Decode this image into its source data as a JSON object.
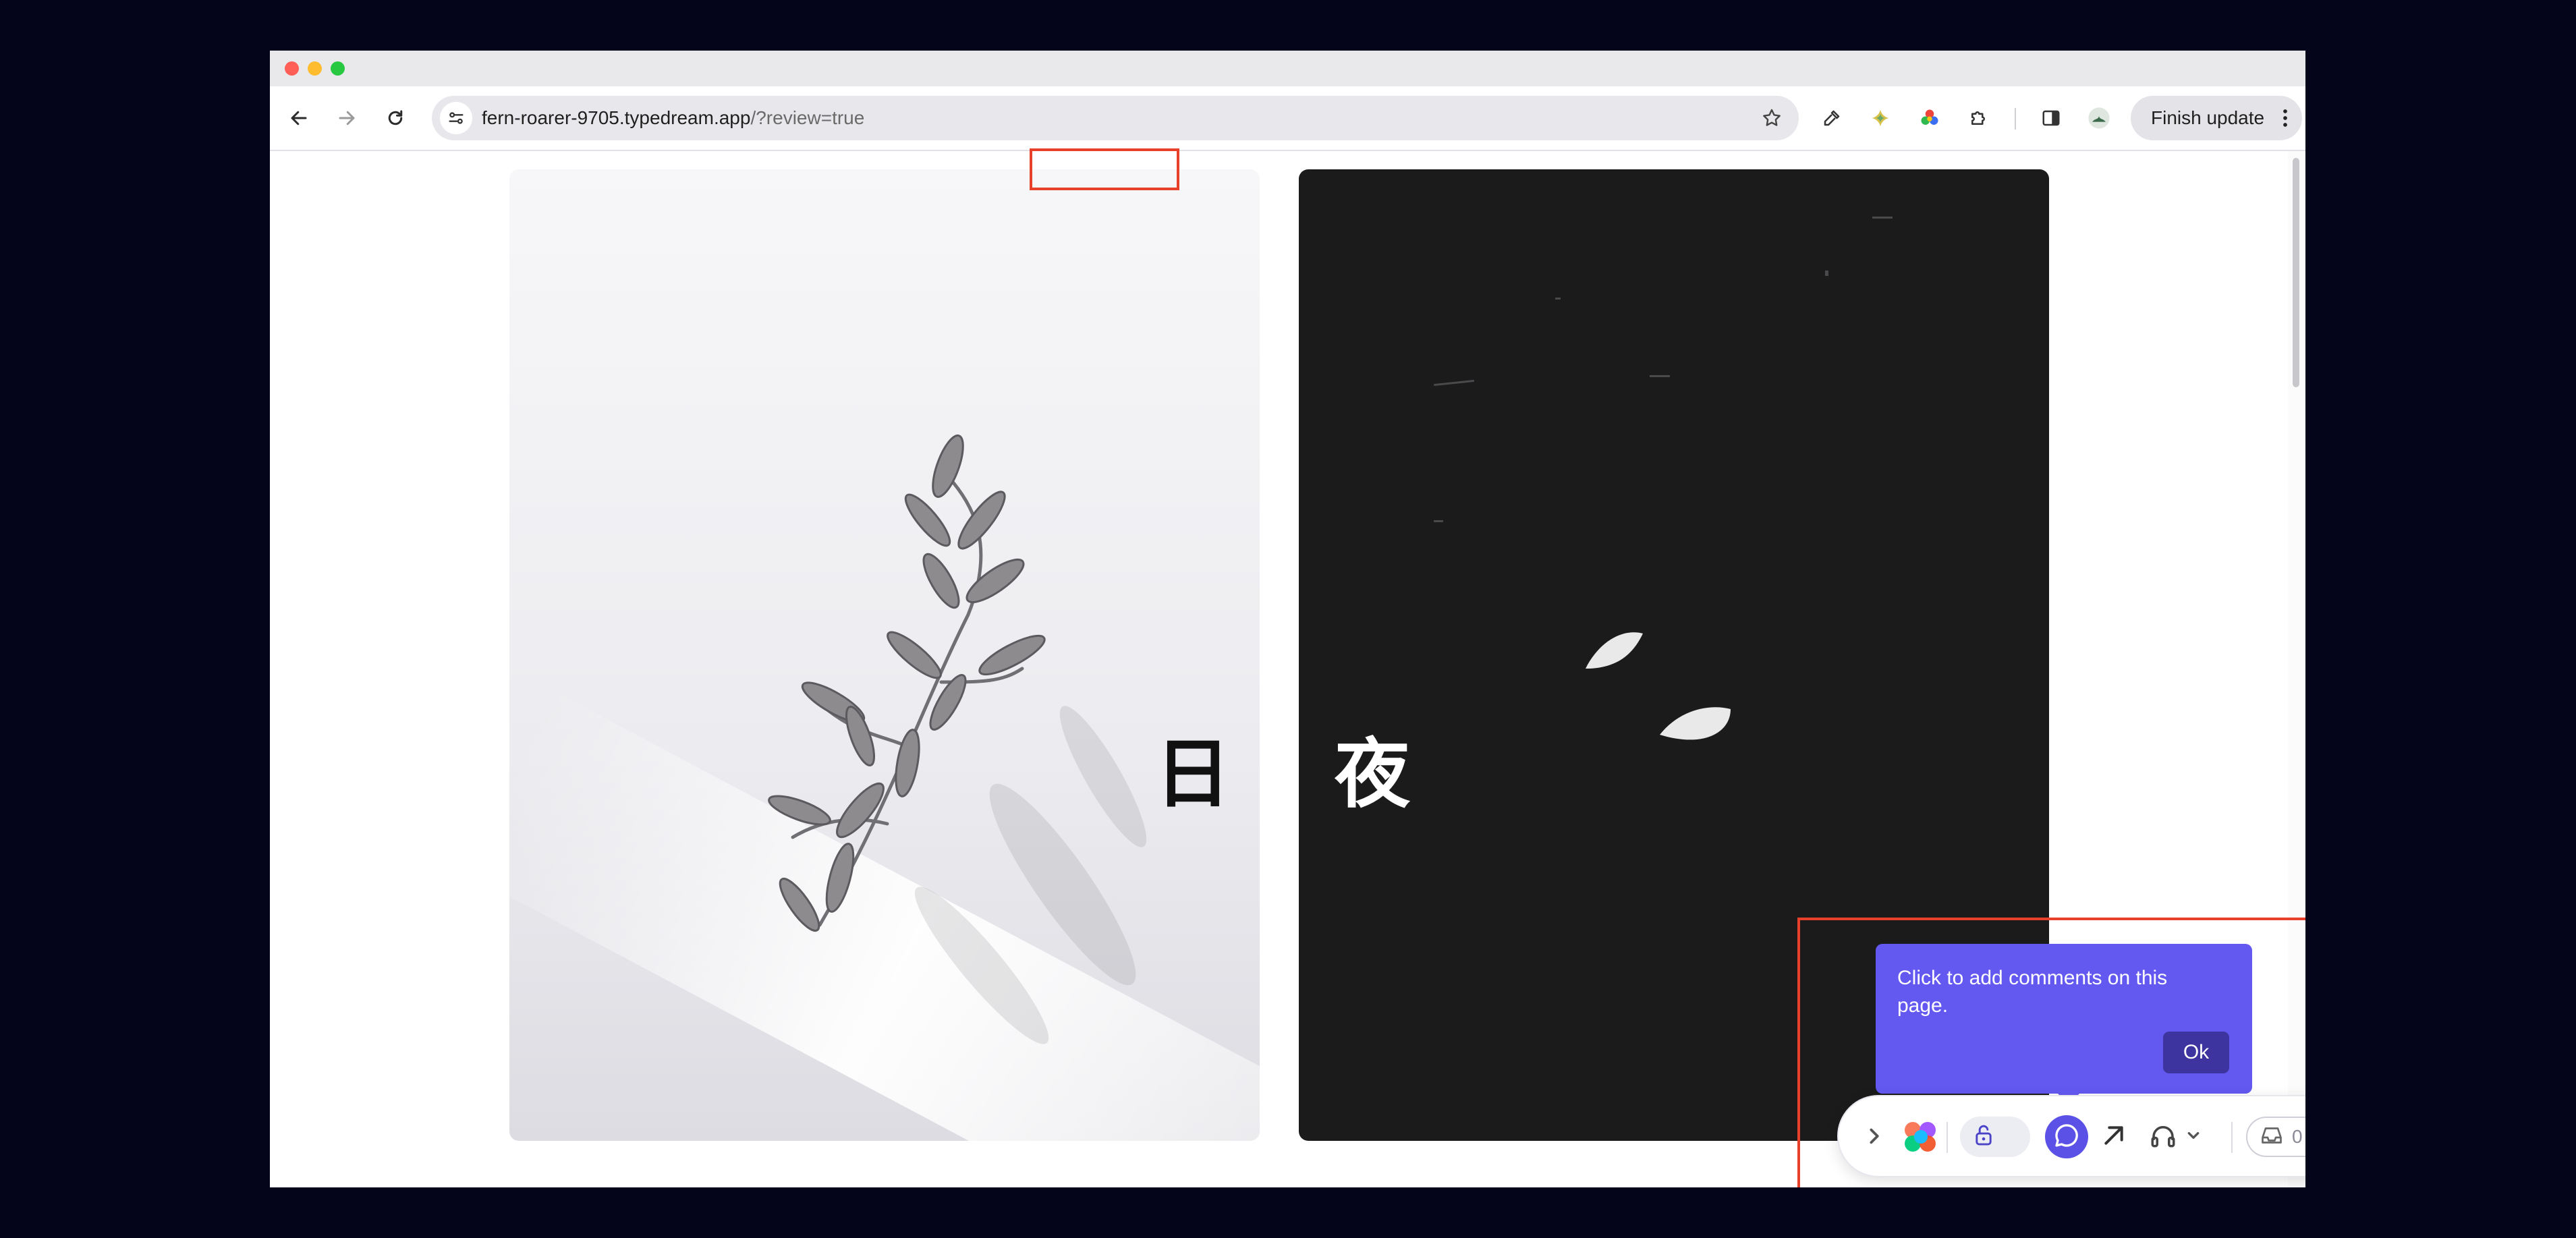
{
  "browser": {
    "url_host": "fern-roarer-9705.typedream.app",
    "url_query": "/?review=true",
    "finish_update_label": "Finish update",
    "icons": [
      "back-icon",
      "forward-icon",
      "reload-icon",
      "site-settings-icon",
      "bookmark-star-icon",
      "eyedropper-extension-icon",
      "gemini-extension-icon",
      "color-wheel-extension-icon",
      "extensions-puzzle-icon",
      "side-panel-icon",
      "profile-icon",
      "more-vert-icon"
    ]
  },
  "page": {
    "day_glyph": "日",
    "night_glyph": "夜"
  },
  "tooltip": {
    "text": "Click to add comments on this page.",
    "ok_label": "Ok"
  },
  "review_bar": {
    "inbox_count": "0",
    "icons": [
      "expand-chevron-icon",
      "figma-logo-icon",
      "unlock-icon",
      "comment-icon",
      "arrow-icon",
      "headphones-icon",
      "inbox-icon",
      "share-icon",
      "avatar",
      "more-vert-icon"
    ]
  },
  "colors": {
    "annotation_red": "#e8412b",
    "tooltip_purple": "#6359f0",
    "comment_active": "#5b51e6",
    "ok_button": "#3e349f",
    "desktop_bg": "#04041a"
  }
}
